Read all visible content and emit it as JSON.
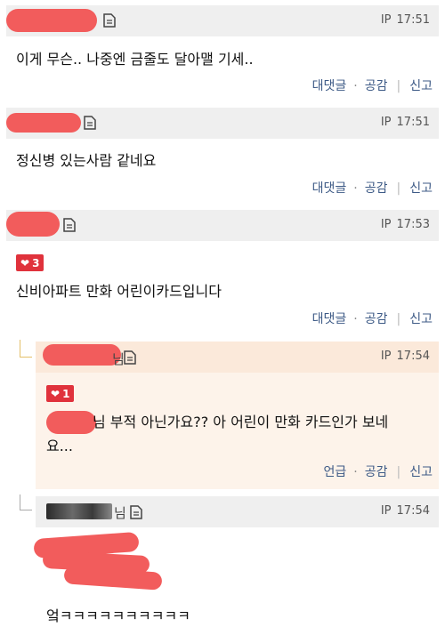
{
  "comments": [
    {
      "ip_label": "IP",
      "time": "17:51",
      "text": "이게 무슨.. 나중엔 금줄도 달아맬 기세..",
      "actions": {
        "reply": "대댓글",
        "like": "공감",
        "report": "신고"
      }
    },
    {
      "ip_label": "IP",
      "time": "17:51",
      "text": "정신병 있는사람 같네요",
      "actions": {
        "reply": "대댓글",
        "like": "공감",
        "report": "신고"
      }
    },
    {
      "ip_label": "IP",
      "time": "17:53",
      "likes": "3",
      "text": "신비아파트 만화 어린이카드입니다",
      "actions": {
        "reply": "대댓글",
        "like": "공감",
        "report": "신고"
      }
    }
  ],
  "replies": [
    {
      "nick_suffix": "님",
      "ip_label": "IP",
      "time": "17:54",
      "likes": "1",
      "text_line1": "님 부적 아닌가요?? 아 어린이 만화 카드인가 보네",
      "text_line2": "요...",
      "actions": {
        "mention": "언급",
        "like": "공감",
        "report": "신고"
      }
    },
    {
      "nick_suffix": "님",
      "ip_label": "IP",
      "time": "17:54",
      "text": "엌ㅋㅋㅋㅋㅋㅋㅋㅋㅋㅋ"
    }
  ],
  "icons": {
    "document": "document-icon",
    "heart": "heart-icon"
  },
  "colors": {
    "header_bg": "#efefef",
    "reply_header_bg": "#fbe9da",
    "link": "#3d5a86",
    "like_badge": "#e0323c"
  }
}
